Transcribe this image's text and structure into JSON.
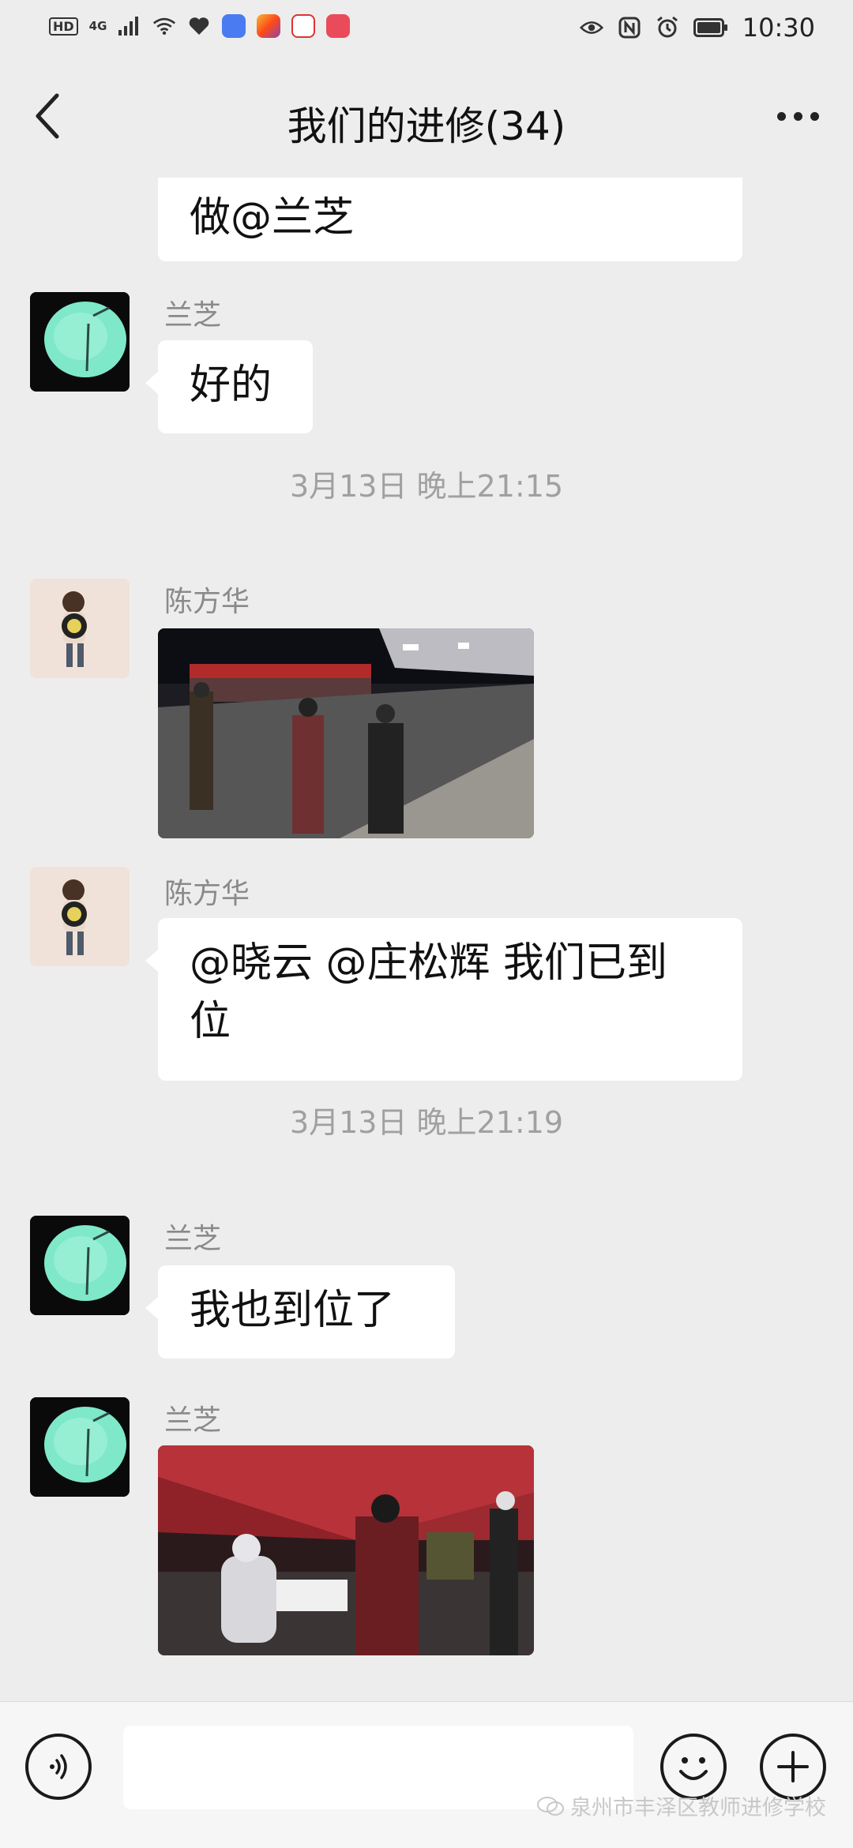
{
  "status_bar": {
    "hd": "HD",
    "network": "4G",
    "time": "10:30",
    "icons": [
      "signal-icon",
      "wifi-icon",
      "health-icon",
      "music-app-icon",
      "tiktok-app-icon",
      "sina-app-icon",
      "book-app-icon",
      "eye-icon",
      "nfc-icon",
      "alarm-icon",
      "battery-icon"
    ]
  },
  "nav": {
    "title": "我们的进修(34)",
    "back_icon": "back-chevron-icon",
    "more_icon": "more-dots-icon"
  },
  "messages": [
    {
      "type": "text",
      "text": "做@兰芝"
    },
    {
      "type": "text",
      "sender": "兰芝",
      "avatar": "lanzhi-avatar",
      "text": "好的"
    },
    {
      "type": "time",
      "text": "3月13日 晚上21:15"
    },
    {
      "type": "image",
      "sender": "陈方华",
      "avatar": "chen-avatar",
      "image": "night-checkpoint-photo"
    },
    {
      "type": "text",
      "sender": "陈方华",
      "avatar": "chen-avatar",
      "text": "@晓云 @庄松辉  我们已到位"
    },
    {
      "type": "time",
      "text": "3月13日 晚上21:19"
    },
    {
      "type": "text",
      "sender": "兰芝",
      "avatar": "lanzhi-avatar",
      "text": "我也到位了"
    },
    {
      "type": "image",
      "sender": "兰芝",
      "avatar": "lanzhi-avatar",
      "image": "red-tent-testing-photo"
    }
  ],
  "input_bar": {
    "voice_icon": "voice-icon",
    "emoji_icon": "emoji-icon",
    "plus_icon": "plus-icon",
    "watermark": "泉州市丰泽区教师进修学校"
  },
  "colors": {
    "background": "#ededed",
    "bubble": "#ffffff",
    "meta_text": "#8a8a8a",
    "avatar_glow": "#7ee8c8"
  }
}
